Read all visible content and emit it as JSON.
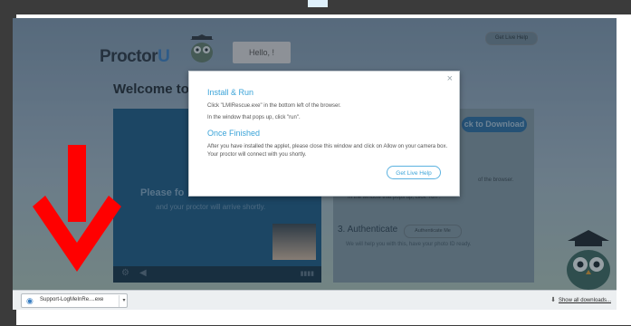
{
  "page": {
    "logo_text": "Proctor",
    "logo_u": "U",
    "hello_text": "Hello, !",
    "live_help_top": "Get Live Help",
    "welcome_text": "Welcome to",
    "video_overlay_bold": "Please fo",
    "video_overlay_sub": "and your proctor will arrive shortly.",
    "download_button": "ck to Download",
    "step_text_a": "of the browser.",
    "step_text_b": "In the window that pops up, click \"run\".",
    "authenticate_label": "3.  Authenticate",
    "authenticate_button": "Authenticate Me",
    "authenticate_sub": "We will help you with this, have your photo ID ready."
  },
  "modal": {
    "close_symbol": "×",
    "heading_install": "Install & Run",
    "install_line1": "Click \"LMIRescue.exe\" in the bottom left of the browser.",
    "install_line2": "In the window that pops up, click \"run\".",
    "heading_finished": "Once Finished",
    "finished_text": "After you have installed the applet, please close this window and click on Allow on your camera box. Your proctor will connect with you shortly.",
    "live_help_button": "Get Live Help"
  },
  "download_bar": {
    "file_name": "Support-LogMeInRe....exe",
    "show_all": "Show all downloads..."
  },
  "colors": {
    "accent": "#3aa3d8",
    "arrow": "#ff0000",
    "frame": "#3b3b3b"
  },
  "icons": {
    "download_item": "download-file-icon",
    "show_all": "download-arrow-icon",
    "arrow": "red-down-arrow-icon"
  }
}
